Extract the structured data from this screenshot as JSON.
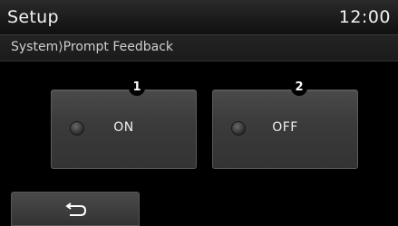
{
  "header": {
    "title": "Setup",
    "clock": "12:00"
  },
  "breadcrumb": {
    "path": "System⟩Prompt Feedback"
  },
  "options": [
    {
      "label": "ON",
      "callout": "1"
    },
    {
      "label": "OFF",
      "callout": "2"
    }
  ],
  "footer": {
    "back_icon": "back-arrow-icon"
  }
}
